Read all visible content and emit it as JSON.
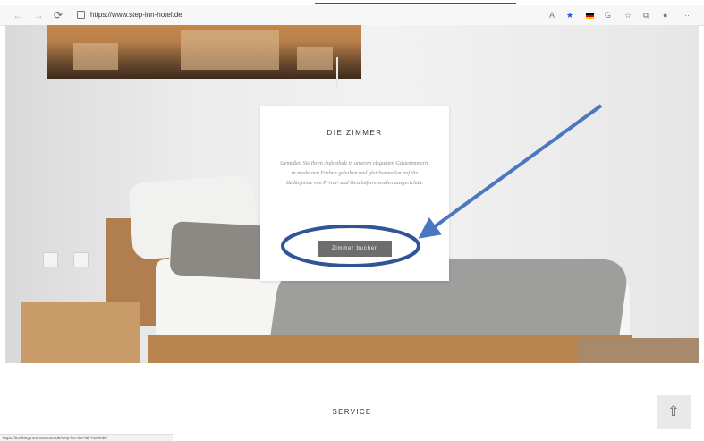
{
  "browser": {
    "url": "https://www.step-inn-hotel.de"
  },
  "hero": {
    "card_title": "DIE ZIMMER",
    "card_text": "Genießen Sie Ihren Aufenthalt in unseren eleganten Gästezimmern, in modernen Farben gehalten und gleichermaßen auf die Bedürfnisse von Privat- und Geschäftsreisenden ausgerichtet.",
    "book_button": "Zimmer buchen"
  },
  "section": {
    "service_heading": "SERVICE"
  },
  "status_url": "https://booking.roomraccoon.de/step-inn-the-fair-hotel/de/",
  "icons": [
    "back-arrow-icon",
    "forward-arrow-icon",
    "reload-icon",
    "lock-icon",
    "read-aloud-icon",
    "favorite-star-icon",
    "flag-de-icon",
    "extension-icon",
    "favorites-icon",
    "collections-icon",
    "profile-icon",
    "more-icon",
    "arrow-up-icon"
  ],
  "colors": {
    "annotation": "#2d5597",
    "arrow": "#4a78c0",
    "button_bg": "#6d6d6d",
    "favorite_star": "#1b57d6"
  }
}
